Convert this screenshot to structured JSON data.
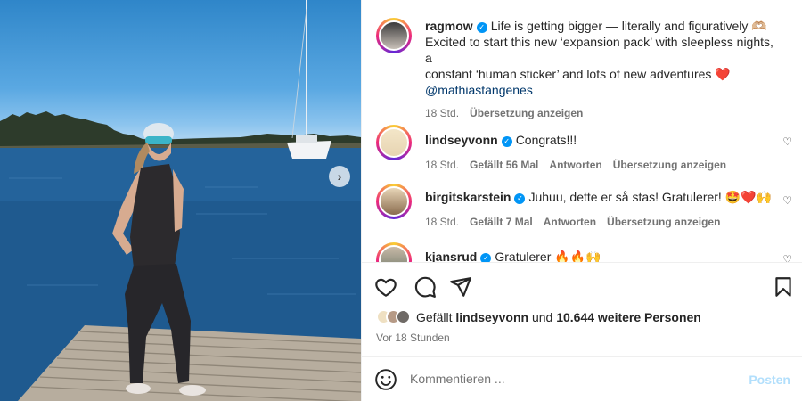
{
  "post": {
    "author": "ragmow",
    "caption_line1": "Life is getting bigger — literally and figuratively 🫶🏼",
    "caption_line2": "Excited to start this new ‘expansion pack’ with sleepless nights, a",
    "caption_line3": "constant ‘human sticker’ and lots of new adventures ❤️",
    "mention": "@mathiastangenes",
    "time": "18 Std.",
    "translate": "Übersetzung anzeigen"
  },
  "comments": [
    {
      "user": "lindseyvonn",
      "text": "Congrats!!!",
      "time": "18 Std.",
      "likes": "Gefällt 56 Mal",
      "reply": "Antworten",
      "translate": "Übersetzung anzeigen"
    },
    {
      "user": "birgitskarstein",
      "text": "Juhuu, dette er så stas! Gratulerer! 🤩❤️🙌",
      "time": "18 Std.",
      "likes": "Gefällt 7 Mal",
      "reply": "Antworten",
      "translate": "Übersetzung anzeigen"
    },
    {
      "user": "kjansrud",
      "text": "Gratulerer 🔥🔥🙌"
    }
  ],
  "likes": {
    "prefix": "Gefällt",
    "user": "lindseyvonn",
    "mid": "und",
    "count": "10.644 weitere Personen"
  },
  "ago": "Vor 18 Stunden",
  "composer": {
    "placeholder": "Kommentieren ...",
    "post_label": "Posten"
  },
  "icons": {
    "like": "heart-icon",
    "comment": "comment-icon",
    "share": "send-icon",
    "save": "bookmark-icon",
    "emoji": "emoji-icon",
    "next": "chevron-right-icon"
  },
  "colors": {
    "verified": "#0095f6",
    "link": "#00376b",
    "post_disabled": "#b2dffc"
  }
}
